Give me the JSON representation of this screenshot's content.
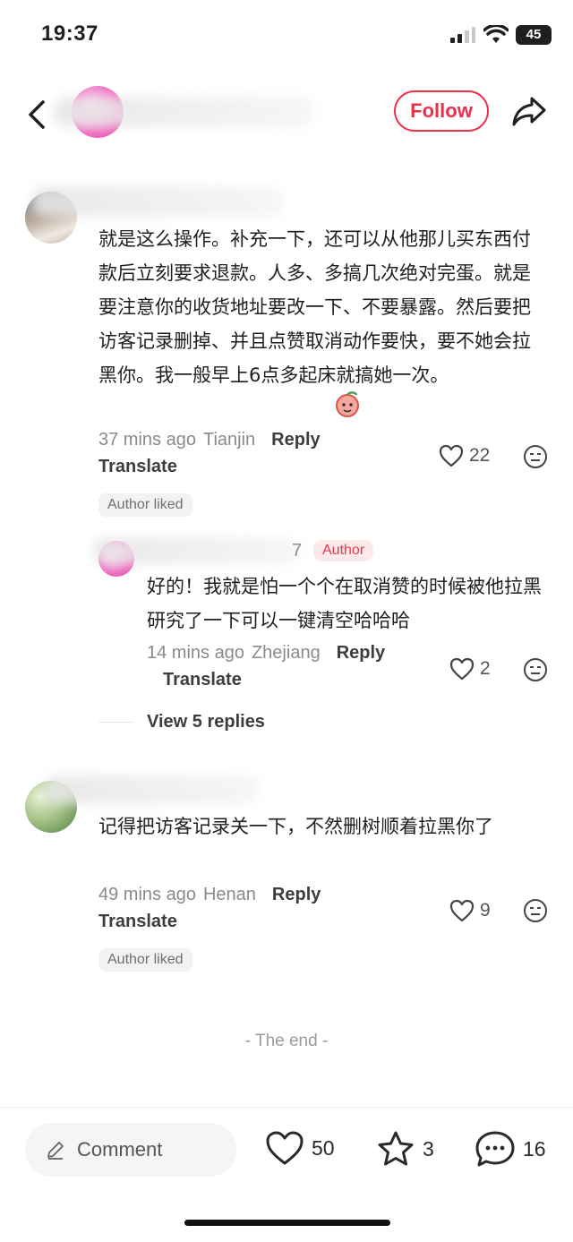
{
  "status_bar": {
    "time": "19:37",
    "battery": "45"
  },
  "header": {
    "follow_label": "Follow"
  },
  "comments": [
    {
      "text": "就是这么操作。补充一下，还可以从他那儿买东西付款后立刻要求退款。人多、多搞几次绝对完蛋。就是要注意你的收货地址要改一下、不要暴露。然后要把访客记录删掉、并且点赞取消动作要快，要不她会拉黑你。我一般早上6点多起床就搞她一次。",
      "time": "37 mins ago",
      "location": "Tianjin",
      "reply_label": "Reply",
      "translate_label": "Translate",
      "likes": "22",
      "badge": "Author liked"
    },
    {
      "text": "好的！我就是怕一个个在取消赞的时候被他拉黑研究了一下可以一键清空哈哈哈",
      "author_badge": "Author",
      "name_suffix": "7",
      "time": "14 mins ago",
      "location": "Zhejiang",
      "reply_label": "Reply",
      "translate_label": "Translate",
      "likes": "2"
    },
    {
      "text": "记得把访客记录关一下，不然删树顺着拉黑你了",
      "time": "49 mins ago",
      "location": "Henan",
      "reply_label": "Reply",
      "translate_label": "Translate",
      "likes": "9",
      "badge": "Author liked"
    }
  ],
  "view_replies": "View 5 replies",
  "the_end": "- The end -",
  "bottom_bar": {
    "comment_placeholder": "Comment",
    "likes": "50",
    "stars": "3",
    "comments": "16"
  },
  "colors": {
    "accent": "#ee2f4b",
    "text": "#1f1f1f",
    "muted": "#8a8a8a"
  }
}
